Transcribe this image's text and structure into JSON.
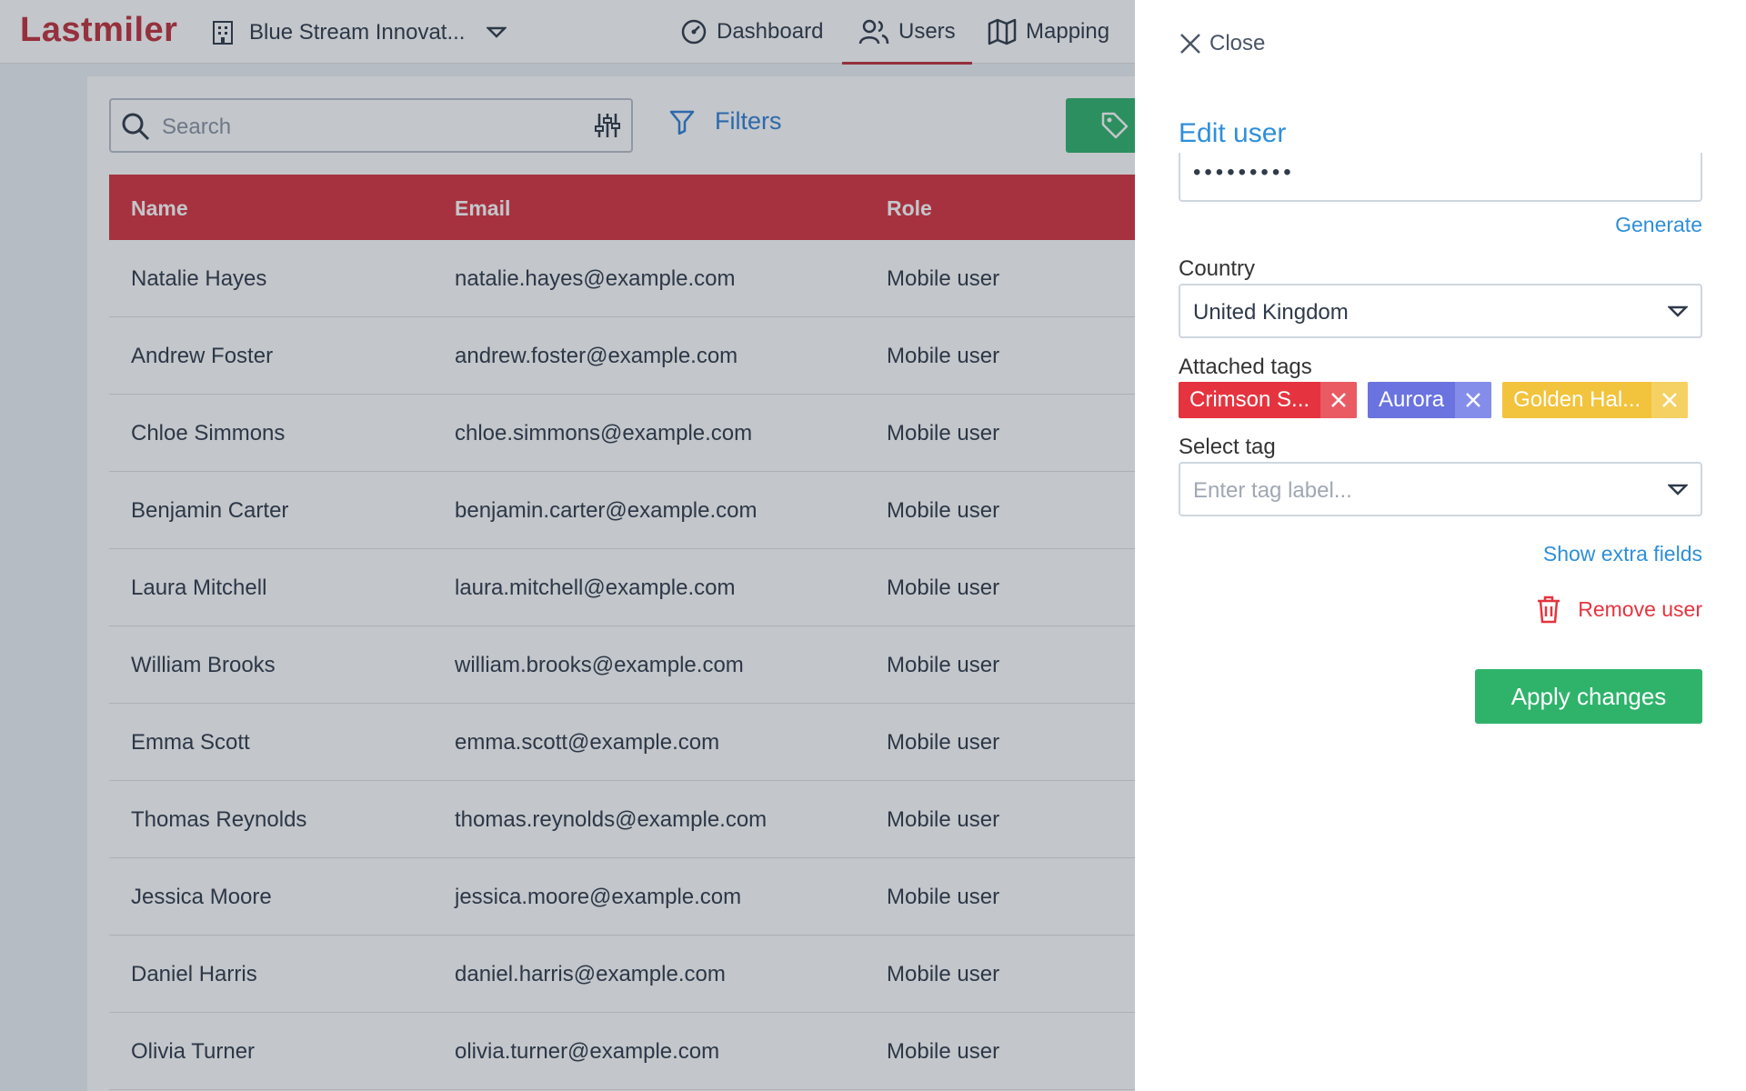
{
  "app": {
    "logo": "Lastmiler",
    "organization": "Blue Stream Innovat..."
  },
  "nav": [
    {
      "label": "Dashboard",
      "icon": "dashboard-icon"
    },
    {
      "label": "Users",
      "icon": "users-icon",
      "active": true
    },
    {
      "label": "Mapping",
      "icon": "map-icon"
    }
  ],
  "toolbar": {
    "search_placeholder": "Search",
    "filters_label": "Filters",
    "tag_button_icon": "tag-icon"
  },
  "table": {
    "columns": [
      "Name",
      "Email",
      "Role"
    ],
    "rows": [
      {
        "name": "Natalie Hayes",
        "email": "natalie.hayes@example.com",
        "role": "Mobile user"
      },
      {
        "name": "Andrew Foster",
        "email": "andrew.foster@example.com",
        "role": "Mobile user"
      },
      {
        "name": "Chloe Simmons",
        "email": "chloe.simmons@example.com",
        "role": "Mobile user"
      },
      {
        "name": "Benjamin Carter",
        "email": "benjamin.carter@example.com",
        "role": "Mobile user"
      },
      {
        "name": "Laura Mitchell",
        "email": "laura.mitchell@example.com",
        "role": "Mobile user"
      },
      {
        "name": "William Brooks",
        "email": "william.brooks@example.com",
        "role": "Mobile user"
      },
      {
        "name": "Emma Scott",
        "email": "emma.scott@example.com",
        "role": "Mobile user"
      },
      {
        "name": "Thomas Reynolds",
        "email": "thomas.reynolds@example.com",
        "role": "Mobile user"
      },
      {
        "name": "Jessica Moore",
        "email": "jessica.moore@example.com",
        "role": "Mobile user"
      },
      {
        "name": "Daniel Harris",
        "email": "daniel.harris@example.com",
        "role": "Mobile user"
      },
      {
        "name": "Olivia Turner",
        "email": "olivia.turner@example.com",
        "role": "Mobile user"
      }
    ]
  },
  "panel": {
    "close_label": "Close",
    "title": "Edit user",
    "password_value": "•••••••••",
    "generate_label": "Generate",
    "country_label": "Country",
    "country_value": "United Kingdom",
    "attached_tags_label": "Attached tags",
    "tags": [
      {
        "label": "Crimson S...",
        "color": "#e5343f"
      },
      {
        "label": "Aurora",
        "color": "#6a73e0"
      },
      {
        "label": "Golden Hal...",
        "color": "#f2c33c"
      }
    ],
    "select_tag_label": "Select tag",
    "select_tag_placeholder": "Enter tag label...",
    "show_extra_label": "Show extra fields",
    "remove_label": "Remove user",
    "apply_label": "Apply changes"
  },
  "colors": {
    "brand": "#c0303c",
    "accent": "#2e8fd9",
    "success": "#2fb36b",
    "danger": "#e5343f"
  }
}
